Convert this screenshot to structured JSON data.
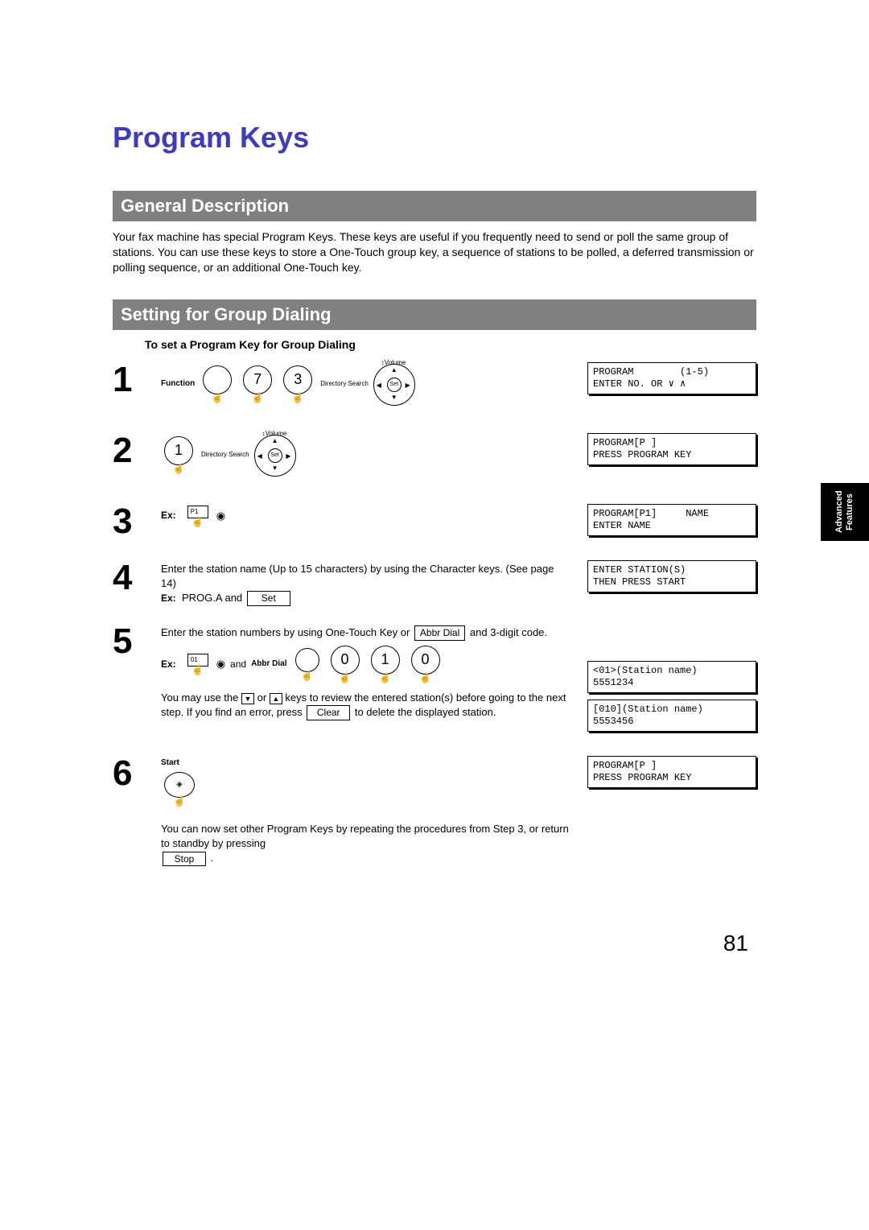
{
  "page": {
    "title": "Program Keys",
    "number": "81"
  },
  "sidetab": {
    "label": "Advanced\nFeatures"
  },
  "general": {
    "heading": "General Description",
    "body": "Your fax machine has special Program Keys.  These keys are useful if you frequently need to send or poll the same group of stations.  You can use these keys to store a One-Touch group key, a sequence of stations to be polled, a deferred transmission or polling sequence, or an additional One-Touch key."
  },
  "setting": {
    "heading": "Setting for Group Dialing",
    "subhead": "To set a Program Key for Group Dialing"
  },
  "steps": [
    {
      "num": "1",
      "body_items": {
        "function_label": "Function",
        "k1": "7",
        "k2": "3",
        "volume_label": "Volume",
        "dir_search_label": "Directory\nSearch",
        "set_label": "Set"
      },
      "lcd": "PROGRAM        (1-5)\nENTER NO. OR ∨ ∧"
    },
    {
      "num": "2",
      "body_items": {
        "k1": "1",
        "volume_label": "Volume",
        "dir_search_label": "Directory\nSearch",
        "set_label": "Set"
      },
      "lcd": "PROGRAM[P ]\nPRESS PROGRAM KEY"
    },
    {
      "num": "3",
      "body_items": {
        "ex_label": "Ex:",
        "p1_label": "P1"
      },
      "lcd": "PROGRAM[P1]     NAME\nENTER NAME"
    },
    {
      "num": "4",
      "body_text_a": "Enter the station name (Up to 15 characters) by using the Character keys. (See page 14)",
      "ex_label": "Ex: ",
      "ex_value": "PROG.A and",
      "set_box": "Set",
      "lcd": "ENTER STATION(S)\nTHEN PRESS START"
    },
    {
      "num": "5",
      "body_text_a": "Enter the station numbers by using One-Touch Key or",
      "abbr_box": "Abbr Dial",
      "body_text_b": " and 3-digit code.",
      "ex_label": "Ex:",
      "one_label": "01",
      "and_label": "and",
      "abbr_label": "Abbr Dial",
      "d0": "0",
      "d1": "1",
      "d2": "0",
      "body_text_c_a": "You may use the ",
      "body_text_c_b": " or ",
      "body_text_c_c": " keys to review the entered station(s) before going to the next step. If you find an error, press ",
      "clear_box": "Clear",
      "body_text_c_d": " to delete the displayed station.",
      "lcd1": "<01>(Station name)\n5551234",
      "lcd2": "[010](Station name)\n5553456"
    },
    {
      "num": "6",
      "start_label": "Start",
      "body_text_a": "You can now set other Program Keys by repeating the procedures from Step 3, or return to standby by pressing",
      "stop_box": "Stop",
      "period": ".",
      "lcd": "PROGRAM[P ]\nPRESS PROGRAM KEY"
    }
  ]
}
